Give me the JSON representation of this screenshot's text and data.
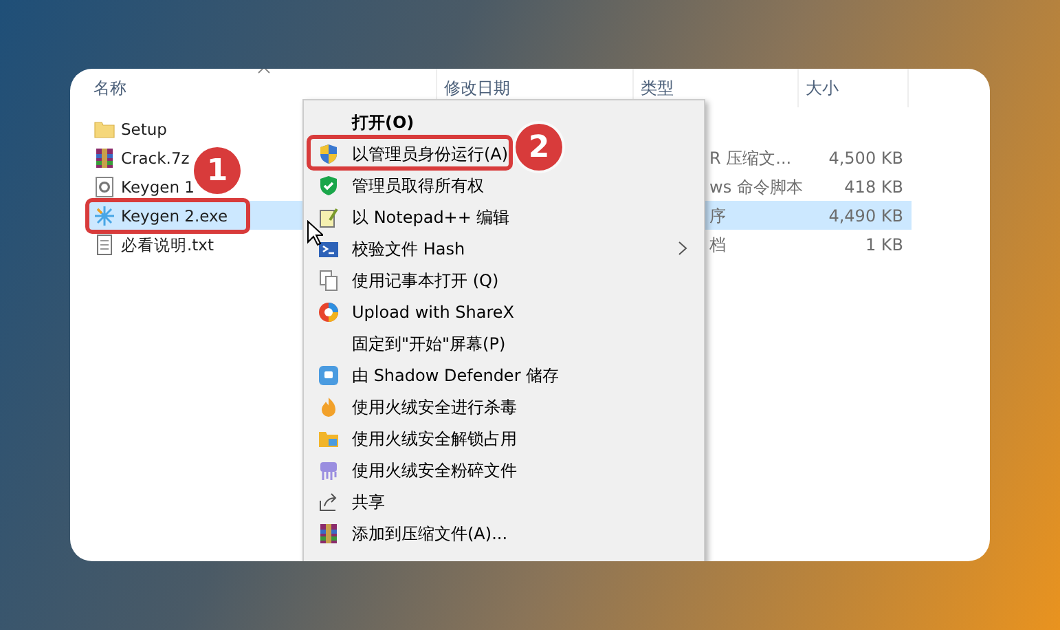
{
  "columns": [
    {
      "label": "名称"
    },
    {
      "label": "修改日期"
    },
    {
      "label": "类型"
    },
    {
      "label": "大小"
    }
  ],
  "files": [
    {
      "name": "Setup",
      "kind": "folder",
      "selected": false
    },
    {
      "name": "Crack.7z",
      "kind": "archive",
      "type": "R 压缩文...",
      "size": "4,500 KB",
      "selected": false
    },
    {
      "name": "Keygen 1",
      "kind": "script",
      "type": "ws 命令脚本",
      "size": "418 KB",
      "selected": false
    },
    {
      "name": "Keygen 2.exe",
      "kind": "exe",
      "type": "序",
      "size": "4,490 KB",
      "selected": true
    },
    {
      "name": "必看说明.txt",
      "kind": "text",
      "type": "档",
      "size": "1 KB",
      "selected": false
    }
  ],
  "context_menu": [
    {
      "label": "打开(O)",
      "default": true
    },
    {
      "label": "以管理员身份运行(A)",
      "default": false
    },
    {
      "label": "管理员取得所有权",
      "default": false
    },
    {
      "label": "以 Notepad++ 编辑",
      "default": false
    },
    {
      "label": "校验文件 Hash",
      "default": false,
      "submenu": true
    },
    {
      "label": "使用记事本打开 (Q)",
      "default": false
    },
    {
      "label": "Upload with ShareX",
      "default": false
    },
    {
      "label": "固定到\"开始\"屏幕(P)",
      "default": false
    },
    {
      "label": "由 Shadow Defender 储存",
      "default": false
    },
    {
      "label": "使用火绒安全进行杀毒",
      "default": false
    },
    {
      "label": "使用火绒安全解锁占用",
      "default": false
    },
    {
      "label": "使用火绒安全粉碎文件",
      "default": false
    },
    {
      "label": "共享",
      "default": false
    },
    {
      "label": "添加到压缩文件(A)...",
      "default": false
    }
  ],
  "annotations": [
    {
      "label": "1"
    },
    {
      "label": "2"
    }
  ]
}
